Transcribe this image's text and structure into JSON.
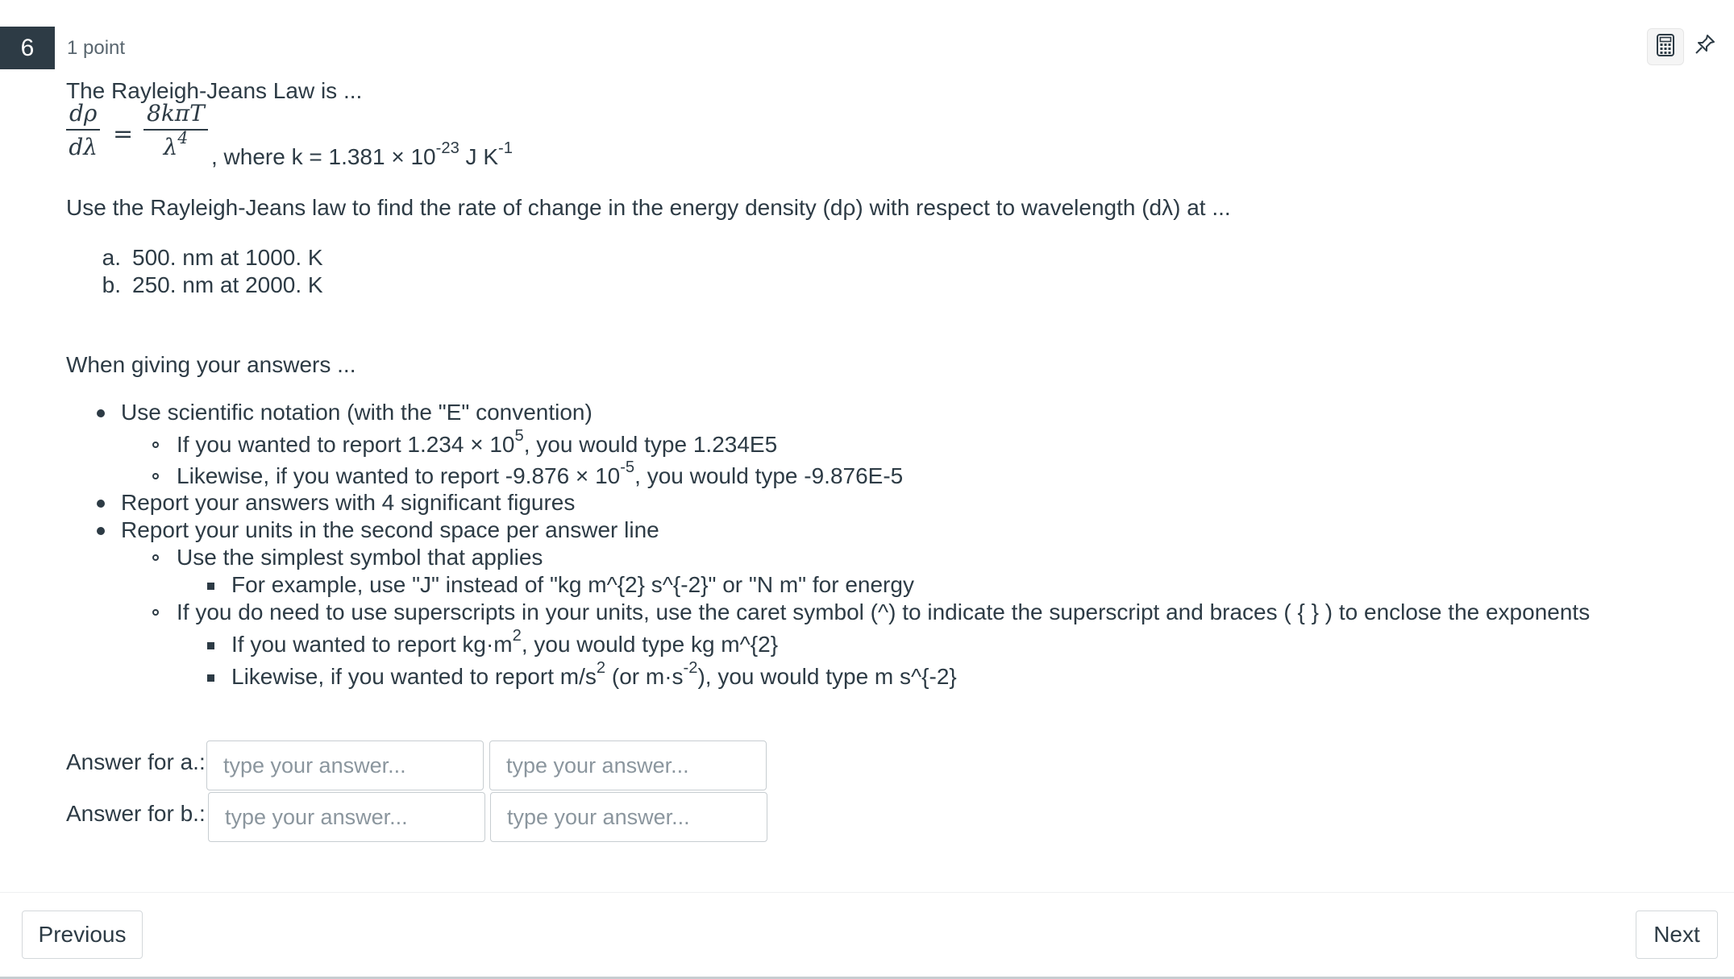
{
  "question": {
    "number": "6",
    "points": "1 point",
    "intro": "The Rayleigh-Jeans Law is ...",
    "formula": {
      "lhs_num": "dρ",
      "lhs_den": "dλ",
      "equals": "=",
      "rhs_num": "8kπT",
      "rhs_den_base": "λ",
      "rhs_den_exp": "4",
      "where_text": ", where k = 1.381 × 10",
      "where_exp": "-23",
      "unit_text": " J K",
      "unit_exp": "-1"
    },
    "task": "Use the Rayleigh-Jeans law to find the rate of change in the energy density (dρ) with respect to wavelength (dλ) at ...",
    "parts": [
      {
        "label": "a.",
        "text": "500. nm at 1000. K"
      },
      {
        "label": "b.",
        "text": "250. nm at 2000. K"
      }
    ],
    "when_giving": "When giving your answers ...",
    "rules": {
      "r1": "Use scientific notation (with the \"E\" convention)",
      "r1a_pre": "If you wanted to report 1.234 × 10",
      "r1a_exp": "5",
      "r1a_post": ", you would type 1.234E5",
      "r1b_pre": "Likewise, if you wanted to report -9.876 × 10",
      "r1b_exp": "-5",
      "r1b_post": ", you would type -9.876E-5",
      "r2": "Report your answers with 4 significant figures",
      "r3": "Report your units in the second space per answer line",
      "r3a": "Use the simplest symbol that applies",
      "r3a1": "For example, use \"J\" instead of \"kg m^{2} s^{-2}\" or \"N m\" for energy",
      "r3b": "If you do need to use superscripts in your units, use the caret symbol (^) to indicate the superscript and braces ( { } ) to enclose the exponents",
      "r3b1_pre": "If you wanted to report kg·m",
      "r3b1_exp": "2",
      "r3b1_post": ", you would type kg m^{2}",
      "r3b2_pre": "Likewise, if you wanted to report m/s",
      "r3b2_exp": "2",
      "r3b2_mid": " (or m·s",
      "r3b2_exp2": "-2",
      "r3b2_post": "), you would type m s^{-2}"
    },
    "answers": {
      "a_label": "Answer for a.:",
      "b_label": "Answer for b.:",
      "placeholder": "type your answer...",
      "a_value": "",
      "a_units": "",
      "b_value": "",
      "b_units": ""
    }
  },
  "tools": {
    "calculator_icon": "calculator-icon",
    "pin_icon": "pin-icon"
  },
  "nav": {
    "previous": "Previous",
    "next": "Next"
  }
}
